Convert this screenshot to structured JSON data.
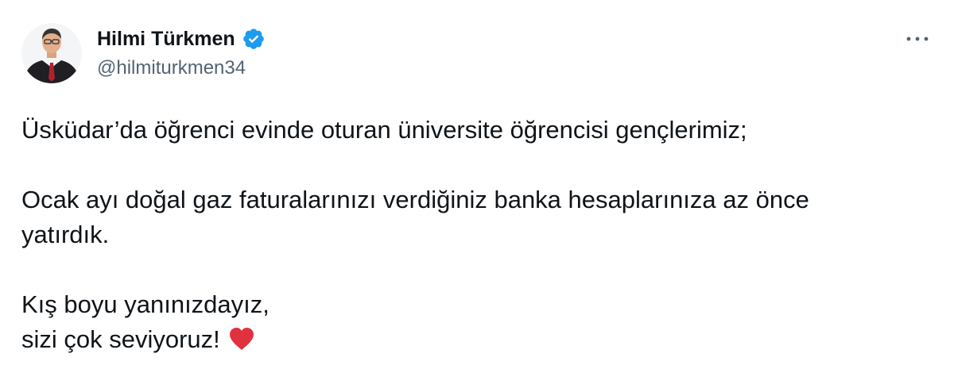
{
  "author": {
    "display_name": "Hilmi Türkmen",
    "handle": "@hilmiturkmen34",
    "verified_icon": "verified-badge-icon",
    "avatar_icon": "avatar"
  },
  "menu": {
    "more_icon": "more-options-icon",
    "more_label": "···"
  },
  "tweet": {
    "line_1": "Üsküdar’da öğrenci evinde oturan üniversite öğrencisi gençlerimiz;",
    "line_2": "Ocak ayı doğal gaz faturalarınızı verdiğiniz banka hesaplarınıza az önce",
    "line_3": "yatırdık.",
    "line_4": "Kış boyu yanınızdayız,",
    "line_5": "sizi çok seviyoruz!",
    "emoji": "red-heart-icon"
  },
  "colors": {
    "text": "#0f1419",
    "secondary_text": "#536471",
    "verified_blue": "#1d9bf0",
    "heart_red": "#e0323e"
  }
}
